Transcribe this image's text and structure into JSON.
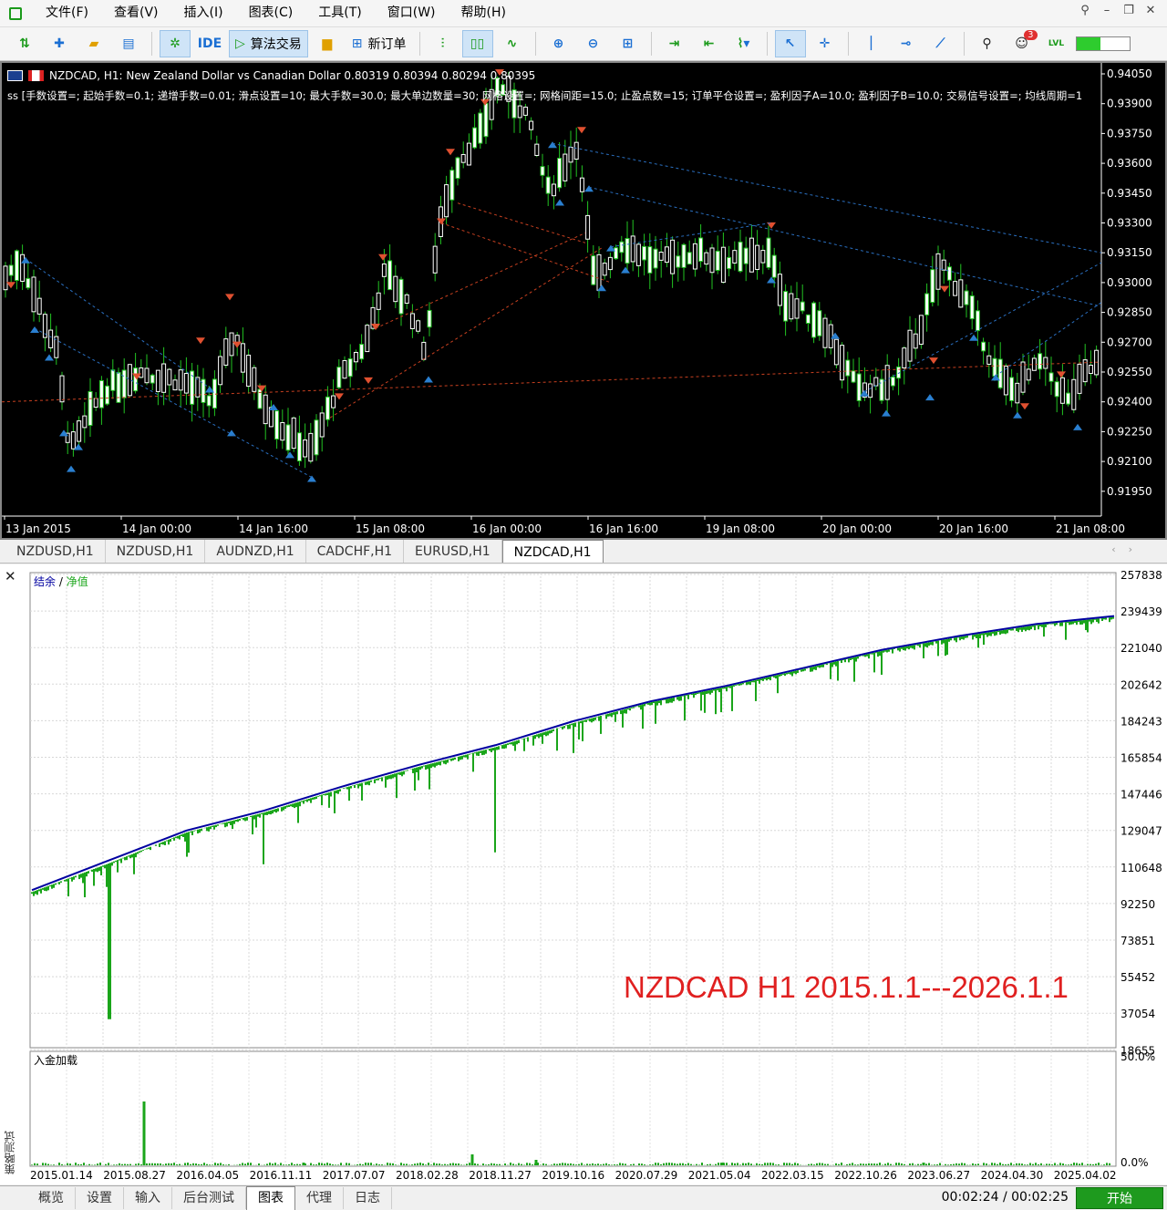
{
  "menu": [
    "文件(F)",
    "查看(V)",
    "插入(I)",
    "图表(C)",
    "工具(T)",
    "窗口(W)",
    "帮助(H)"
  ],
  "toolbar": {
    "ide_label": "IDE",
    "algo_label": "算法交易",
    "new_order_label": "新订单",
    "notif_count": "3",
    "lvl_label": "LVL"
  },
  "chart": {
    "header": "NZDCAD, H1:  New Zealand Dollar vs Canadian Dollar  0.80319 0.80394 0.80294 0.80395",
    "params": "ss [手数设置=; 起始手数=0.1; 递增手数=0.01; 滑点设置=10; 最大手数=30.0; 最大单边数量=30; 网格设置=; 网格间距=15.0; 止盈点数=15; 订单平仓设置=; 盈利因子A=10.0; 盈利因子B=10.0; 交易信号设置=; 均线周期=1",
    "price_labels": [
      "0.94050",
      "0.93900",
      "0.93750",
      "0.93600",
      "0.93450",
      "0.93300",
      "0.93150",
      "0.93000",
      "0.92850",
      "0.92700",
      "0.92550",
      "0.92400",
      "0.92250",
      "0.92100",
      "0.91950"
    ],
    "time_labels": [
      "13 Jan 2015",
      "14 Jan 00:00",
      "14 Jan 16:00",
      "15 Jan 08:00",
      "16 Jan 00:00",
      "16 Jan 16:00",
      "19 Jan 08:00",
      "20 Jan 00:00",
      "20 Jan 16:00",
      "21 Jan 08:00"
    ],
    "colors": {
      "bg": "#000000",
      "candle": "#ffffff",
      "wick": "#22c422",
      "sell": "#e05030",
      "buy": "#2a7fd0"
    }
  },
  "symbol_tabs": [
    "NZDUSD,H1",
    "NZDUSD,H1",
    "AUDNZD,H1",
    "CADCHF,H1",
    "EURUSD,H1",
    "NZDCAD,H1"
  ],
  "tester": {
    "legend_balance": "结余",
    "legend_sep": " / ",
    "legend_equity": "净值",
    "overlay": "NZDCAD H1 2015.1.1---2026.1.1",
    "y_labels": [
      "257838",
      "239439",
      "221040",
      "202642",
      "184243",
      "165854",
      "147446",
      "129047",
      "110648",
      "92250",
      "73851",
      "55452",
      "37054",
      "18655"
    ],
    "x_labels": [
      "2015.01.14",
      "2015.08.27",
      "2016.04.05",
      "2016.11.11",
      "2017.07.07",
      "2018.02.28",
      "2018.11.27",
      "2019.10.16",
      "2020.07.29",
      "2021.05.04",
      "2022.03.15",
      "2022.10.26",
      "2023.06.27",
      "2024.04.30",
      "2025.04.02"
    ],
    "load_title": "入金加载",
    "load_labels": [
      "50.0%",
      "0.0%"
    ],
    "side_label": "策略测试",
    "colors": {
      "balance": "#0000a0",
      "equity": "#1aa51a",
      "overlay": "#e02020"
    }
  },
  "chart_data": {
    "type": "line",
    "title": "",
    "xlabel": "",
    "ylabel": "",
    "x": [
      "2015.01.14",
      "2015.08.27",
      "2016.04.05",
      "2016.11.11",
      "2017.07.07",
      "2018.02.28",
      "2018.11.27",
      "2019.10.16",
      "2020.07.29",
      "2021.05.04",
      "2022.03.15",
      "2022.10.26",
      "2023.06.27",
      "2024.04.30",
      "2025.04.02"
    ],
    "ylim": [
      18655,
      257838
    ],
    "series": [
      {
        "name": "结余",
        "values": [
          98000,
          113000,
          128000,
          138000,
          150000,
          161000,
          171000,
          183000,
          193000,
          201000,
          210000,
          219000,
          226000,
          232000,
          236000
        ]
      },
      {
        "name": "净值",
        "values": [
          97000,
          111500,
          127000,
          137000,
          149000,
          160000,
          170000,
          182000,
          192500,
          200500,
          209500,
          218500,
          225500,
          231500,
          235500
        ]
      }
    ],
    "min_equity_dips": [
      {
        "x": "2015.08.27",
        "y": 33000
      },
      {
        "x": "2016.11.11",
        "y": 111000
      },
      {
        "x": "2018.11.27",
        "y": 117000
      },
      {
        "x": "2019.10.16",
        "y": 167000
      }
    ],
    "grid": true
  }
}
